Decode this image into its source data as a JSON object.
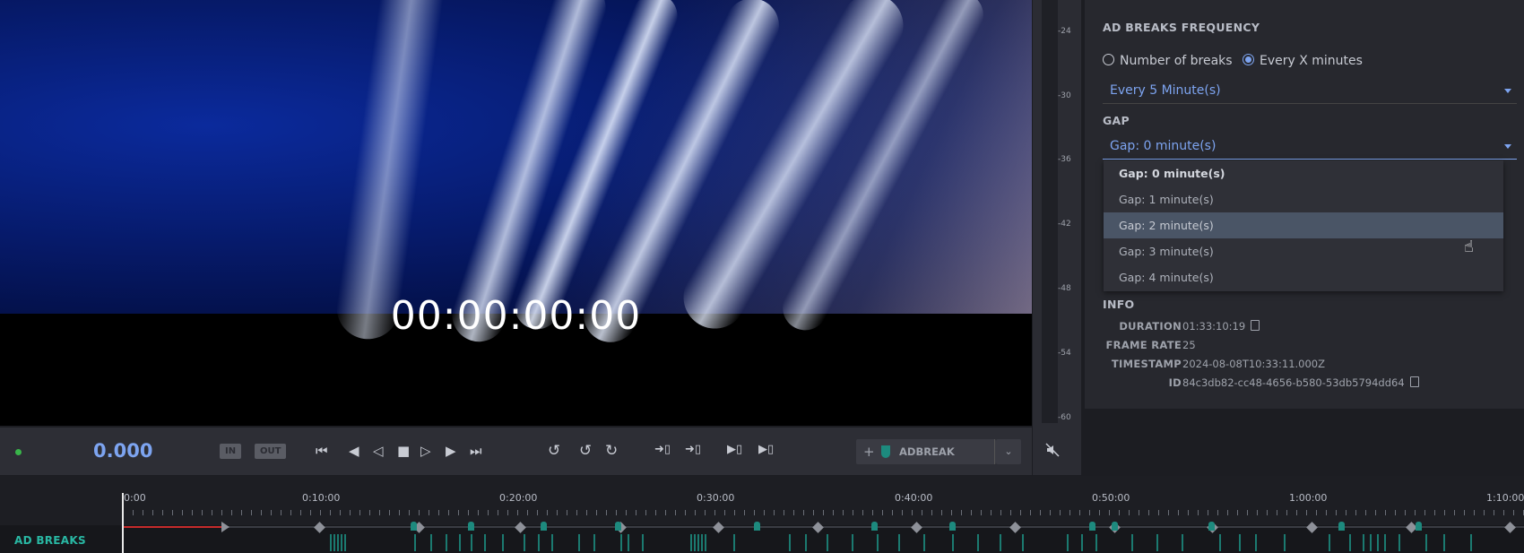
{
  "video": {
    "timecode": "00:00:00:00"
  },
  "meter": {
    "ticks": [
      "-24",
      "-30",
      "-36",
      "-42",
      "-48",
      "-54",
      "-60"
    ],
    "mute_icon": "mute-icon"
  },
  "panel": {
    "frequency_title": "AD BREAKS FREQUENCY",
    "radio_number": "Number of breaks",
    "radio_every": "Every X minutes",
    "frequency_select": "Every 5 Minute(s)",
    "gap_title": "GAP",
    "gap_select": "Gap: 0 minute(s)",
    "gap_options": [
      "Gap: 0 minute(s)",
      "Gap: 1 minute(s)",
      "Gap: 2 minute(s)",
      "Gap: 3 minute(s)",
      "Gap: 4 minute(s)"
    ],
    "info_title": "INFO",
    "info": [
      {
        "key": "DURATION",
        "value": "01:33:10:19"
      },
      {
        "key": "FRAME RATE",
        "value": "25"
      },
      {
        "key": "TIMESTAMP",
        "value": "2024-08-08T10:33:11.000Z"
      },
      {
        "key": "ID",
        "value": "84c3db82-cc48-4656-b580-53db5794dd64"
      }
    ]
  },
  "transport": {
    "counter": "0.000",
    "in_label": "IN",
    "out_label": "OUT",
    "adbreak_label": "ADBREAK",
    "add_symbol": "+"
  },
  "timeline": {
    "labels": [
      "0:00",
      "0:10:00",
      "0:20:00",
      "0:30:00",
      "0:40:00",
      "0:50:00",
      "1:00:00",
      "1:10:00"
    ],
    "track_label": "AD BREAKS"
  },
  "colors": {
    "accent": "#7da4f0",
    "teal": "#29b8a4",
    "status_dot": "#39b54a",
    "playhead_red": "#c62b2b"
  }
}
